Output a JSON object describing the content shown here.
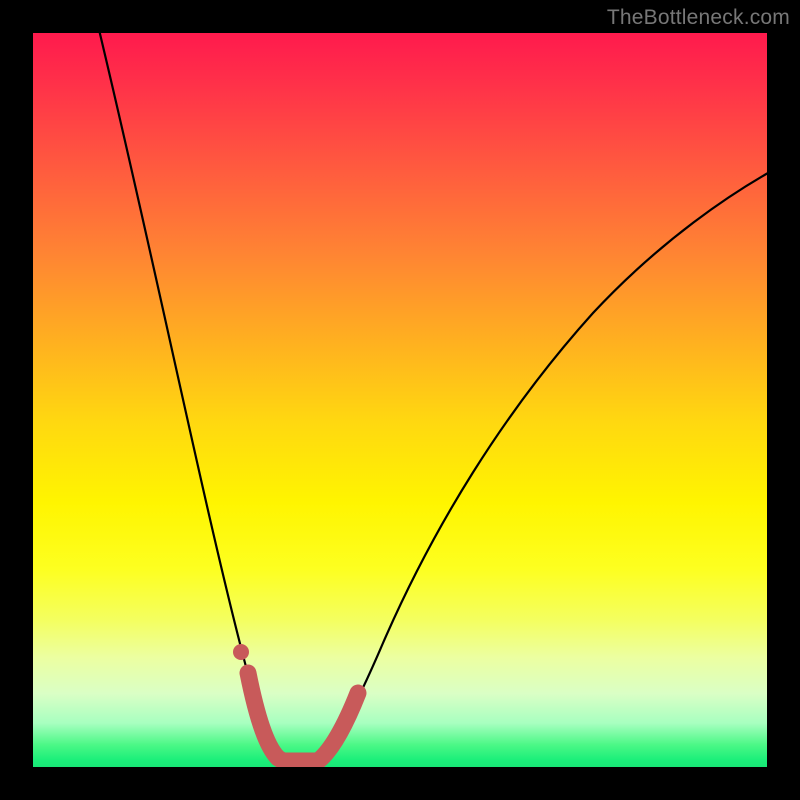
{
  "watermark": "TheBottleneck.com",
  "chart_data": {
    "type": "line",
    "title": "",
    "xlabel": "",
    "ylabel": "",
    "xlim": [
      0,
      100
    ],
    "ylim": [
      0,
      100
    ],
    "x": [
      0,
      5,
      10,
      15,
      20,
      25,
      28,
      30,
      32,
      34,
      36,
      38,
      40,
      45,
      50,
      55,
      60,
      65,
      70,
      75,
      80,
      85,
      90,
      95,
      100
    ],
    "series": [
      {
        "name": "bottleneck-curve",
        "values": [
          110,
          95,
          80,
          64,
          48,
          30,
          15,
          6,
          1,
          0,
          0,
          1,
          5,
          16,
          28,
          38,
          47,
          54,
          61,
          66,
          71,
          75,
          78,
          81,
          83
        ]
      }
    ],
    "highlight": {
      "x": [
        28,
        30,
        32,
        34,
        36,
        38,
        40
      ],
      "values": [
        15,
        6,
        1,
        0,
        0,
        1,
        5
      ],
      "color": "#c85a5a"
    },
    "background_gradient": [
      "#ff1a4d",
      "#ffd810",
      "#fff500",
      "#18e776"
    ]
  }
}
